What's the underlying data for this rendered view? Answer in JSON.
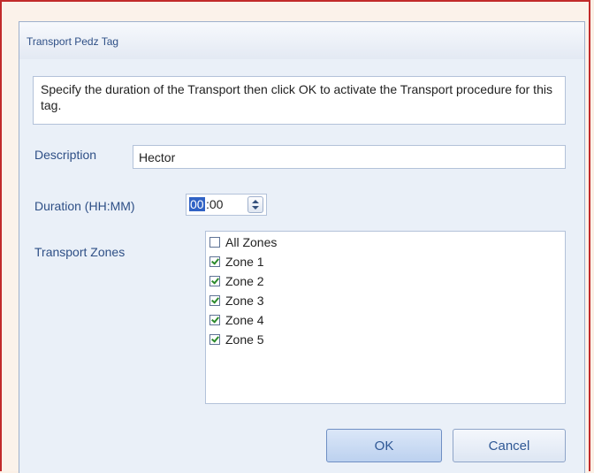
{
  "dialog": {
    "title": "Transport Pedz Tag",
    "instructions": "Specify the duration of the Transport then click OK to  activate the Transport procedure for this tag."
  },
  "description": {
    "label": "Description",
    "value": "Hector"
  },
  "duration": {
    "label": "Duration (HH:MM)",
    "hours": "00",
    "rest": ":00"
  },
  "zones": {
    "label": "Transport Zones",
    "items": [
      {
        "label": "All Zones",
        "checked": false
      },
      {
        "label": "Zone 1",
        "checked": true
      },
      {
        "label": "Zone 2",
        "checked": true
      },
      {
        "label": "Zone 3",
        "checked": true
      },
      {
        "label": "Zone 4",
        "checked": true
      },
      {
        "label": "Zone 5",
        "checked": true
      }
    ]
  },
  "buttons": {
    "ok": "OK",
    "cancel": "Cancel"
  }
}
